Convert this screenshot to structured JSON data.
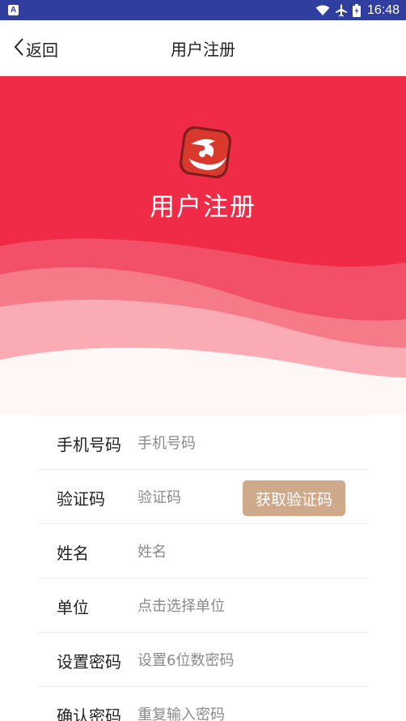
{
  "status_bar": {
    "notification_icon": "A",
    "time": "16:48",
    "icons": [
      "wifi-icon",
      "airplane-icon",
      "battery-icon"
    ]
  },
  "nav": {
    "back_label": "返回",
    "title": "用户注册"
  },
  "banner": {
    "title": "用户注册",
    "background_color": "#ef2b47"
  },
  "form": {
    "phone": {
      "label": "手机号码",
      "placeholder": "手机号码"
    },
    "code": {
      "label": "验证码",
      "placeholder": "验证码",
      "button_label": "获取验证码"
    },
    "name": {
      "label": "姓名",
      "placeholder": "姓名"
    },
    "unit": {
      "label": "单位",
      "placeholder": "点击选择单位"
    },
    "password": {
      "label": "设置密码",
      "placeholder": "设置6位数密码"
    },
    "confirm": {
      "label": "确认密码",
      "placeholder": "重复输入密码"
    }
  },
  "colors": {
    "status_bar": "#303f9f",
    "accent": "#ef2b47",
    "code_button": "#cfaa8a"
  }
}
